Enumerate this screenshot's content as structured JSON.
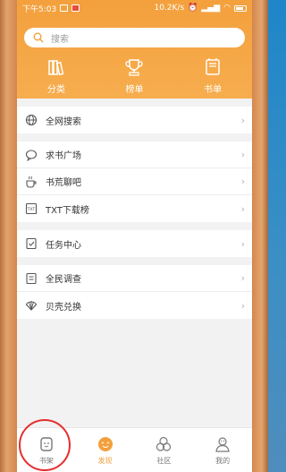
{
  "status_bar": {
    "time": "下午5:03",
    "speed": "10.2K/s",
    "battery_pct": "81%"
  },
  "search": {
    "placeholder": "搜索"
  },
  "categories": [
    {
      "label": "分类",
      "icon": "books-icon"
    },
    {
      "label": "榜单",
      "icon": "trophy-icon"
    },
    {
      "label": "书单",
      "icon": "booklist-icon"
    }
  ],
  "menu_groups": [
    [
      {
        "label": "全网搜索",
        "icon": "globe-icon"
      }
    ],
    [
      {
        "label": "求书广场",
        "icon": "chat-icon"
      },
      {
        "label": "书荒聊吧",
        "icon": "coffee-icon"
      },
      {
        "label": "TXT下载榜",
        "icon": "txt-icon"
      }
    ],
    [
      {
        "label": "任务中心",
        "icon": "task-icon"
      }
    ],
    [
      {
        "label": "全民调查",
        "icon": "survey-icon"
      },
      {
        "label": "贝壳兑换",
        "icon": "shell-icon"
      }
    ]
  ],
  "tabs": [
    {
      "label": "书架",
      "icon": "bookshelf-icon",
      "active": false
    },
    {
      "label": "发现",
      "icon": "discover-icon",
      "active": true
    },
    {
      "label": "社区",
      "icon": "community-icon",
      "active": false
    },
    {
      "label": "我的",
      "icon": "profile-icon",
      "active": false
    }
  ],
  "colors": {
    "accent": "#f3a03d",
    "highlight": "#e62e2e"
  }
}
